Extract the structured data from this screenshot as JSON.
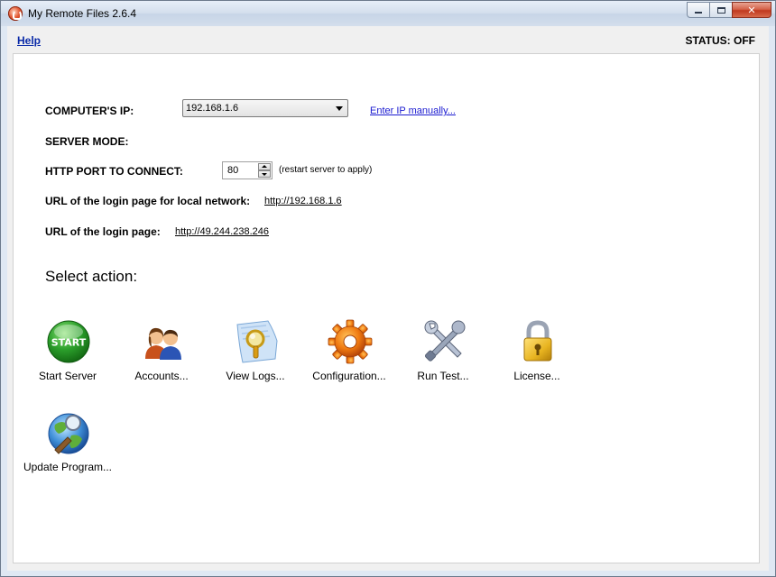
{
  "window": {
    "title": "My Remote Files 2.6.4",
    "controls": {
      "minimize": "minimize",
      "maximize": "maximize",
      "close": "close"
    }
  },
  "menu": {
    "help": "Help"
  },
  "status": "STATUS: OFF",
  "form": {
    "ip_label": "COMPUTER'S IP:",
    "ip_value": "192.168.1.6",
    "enter_ip_link": "Enter IP manually...",
    "server_mode_label": "SERVER MODE:",
    "port_label": "HTTP PORT TO CONNECT:",
    "port_value": "80",
    "port_hint": "(restart server to apply)",
    "local_url_label": "URL of the login page for local network:",
    "local_url": "http://192.168.1.6",
    "public_url_label": "URL of the login page:",
    "public_url": "http://49.244.238.246"
  },
  "actions_title": "Select action:",
  "actions": [
    {
      "label": "Start Server",
      "icon": "start-icon",
      "badge": "START"
    },
    {
      "label": "Accounts...",
      "icon": "accounts-icon"
    },
    {
      "label": "View Logs...",
      "icon": "view-logs-icon"
    },
    {
      "label": "Configuration...",
      "icon": "gear-icon"
    },
    {
      "label": "Run Test...",
      "icon": "wrench-icon"
    },
    {
      "label": "License...",
      "icon": "lock-icon"
    },
    {
      "label": "Update Program...",
      "icon": "update-globe-icon"
    }
  ],
  "colors": {
    "start_green": "#2ca02c",
    "link_blue": "#1a1ad0",
    "gear_orange": "#f07a10",
    "lock_gold": "#e8b420"
  }
}
